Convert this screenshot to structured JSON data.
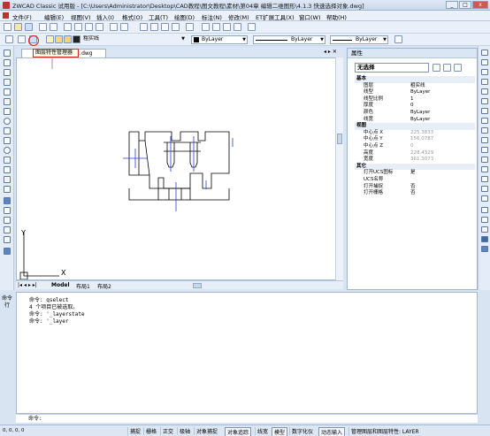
{
  "title": {
    "text": "ZWCAD Classic 试用版 - [C:\\Users\\Administrator\\Desktop\\CAD教程\\图文教程\\素材\\第04章 编辑二维图形\\4.1.3 快速选择对象.dwg]"
  },
  "window_buttons": {
    "min": "_",
    "max": "□",
    "close": "x"
  },
  "menu": [
    "文件(F)",
    "编辑(E)",
    "视图(V)",
    "插入(I)",
    "格式(O)",
    "工具(T)",
    "绘图(D)",
    "标注(N)",
    "修改(M)",
    "ET扩展工具(X)",
    "窗口(W)",
    "帮助(H)"
  ],
  "toolbar": {
    "layer_name": "粗实线",
    "color_by": "ByLayer",
    "linetype_by": "ByLayer",
    "lineweight_by": "ByLayer"
  },
  "tooltip": {
    "text": "图层特性管理器"
  },
  "drawing_tab": {
    "label": "4.1.3 快速选择对象.dwg"
  },
  "layout_tabs": [
    "Model",
    "布局1",
    "布局2"
  ],
  "ucs": {
    "x": "X",
    "y": "Y"
  },
  "properties": {
    "header": "属性",
    "selection": "无选择",
    "rows": [
      {
        "key": "基本",
        "group": true
      },
      {
        "key": "图层",
        "value": "粗实线"
      },
      {
        "key": "线型",
        "value": "ByLayer"
      },
      {
        "key": "线型比例",
        "value": "1"
      },
      {
        "key": "厚度",
        "value": "0"
      },
      {
        "key": "颜色",
        "value": "ByLayer"
      },
      {
        "key": "线宽",
        "value": "ByLayer"
      },
      {
        "key": "视图",
        "group": true
      },
      {
        "key": "中心点 X",
        "value": "225.3833",
        "gray": true
      },
      {
        "key": "中心点 Y",
        "value": "156.0787",
        "gray": true
      },
      {
        "key": "中心点 Z",
        "value": "0",
        "gray": true
      },
      {
        "key": "高度",
        "value": "228.4329",
        "gray": true
      },
      {
        "key": "宽度",
        "value": "361.3073",
        "gray": true
      },
      {
        "key": "其它",
        "group": true
      },
      {
        "key": "打开UCS图标",
        "value": "是"
      },
      {
        "key": "UCS名称",
        "value": ""
      },
      {
        "key": "打开捕捉",
        "value": "否"
      },
      {
        "key": "打开栅格",
        "value": "否"
      }
    ]
  },
  "command": {
    "label": "命令行",
    "lines": [
      "命令: qselect",
      "4 个项目已被选取。",
      "命令: '_layerstate",
      "命令: '_layer"
    ],
    "prompt": "命令:"
  },
  "status": {
    "coords": "0, 0, 0, 0",
    "buttons": [
      "捕捉",
      "栅格",
      "正交",
      "极轴",
      "对象捕捉",
      "对象追踪",
      "线宽",
      "模型",
      "数字化仪",
      "动态输入",
      "管理图层和图层特性: LAYER"
    ]
  },
  "colors": {
    "accent": "#d91c1c",
    "chrome": "#d8e4f2"
  }
}
